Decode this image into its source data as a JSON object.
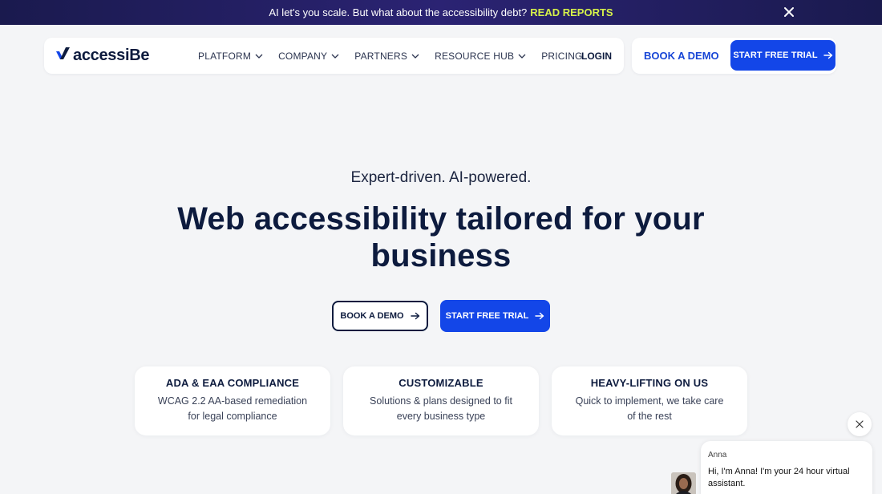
{
  "announcement": {
    "text": "AI let's you scale. But what about the accessibility debt?",
    "link": "READ REPORTS"
  },
  "nav": {
    "logo": "accessiBe",
    "menu": [
      {
        "label": "PLATFORM",
        "has_dropdown": true
      },
      {
        "label": "COMPANY",
        "has_dropdown": true
      },
      {
        "label": "PARTNERS",
        "has_dropdown": true
      },
      {
        "label": "RESOURCE HUB",
        "has_dropdown": true
      },
      {
        "label": "PRICING",
        "has_dropdown": false
      }
    ],
    "login": "LOGIN",
    "book_demo": "BOOK A DEMO",
    "start_trial": "START FREE TRIAL"
  },
  "hero": {
    "eyebrow": "Expert-driven. AI-powered.",
    "headline": "Web accessibility tailored for your business",
    "book_demo": "BOOK A DEMO",
    "start_trial": "START FREE TRIAL"
  },
  "features": [
    {
      "title": "ADA & EAA COMPLIANCE",
      "text": "WCAG 2.2 AA-based remediation for legal compliance"
    },
    {
      "title": "CUSTOMIZABLE",
      "text": "Solutions & plans designed to fit every business type"
    },
    {
      "title": "HEAVY-LIFTING ON US",
      "text": "Quick to implement, we take care of the rest"
    }
  ],
  "chat": {
    "name": "Anna",
    "message": "Hi, I'm Anna! I'm your 24 hour virtual assistant."
  },
  "colors": {
    "brand_blue": "#1346e8",
    "navy": "#0d1b3e",
    "announce_link": "#d6f24a",
    "background": "#f4f5f7"
  }
}
